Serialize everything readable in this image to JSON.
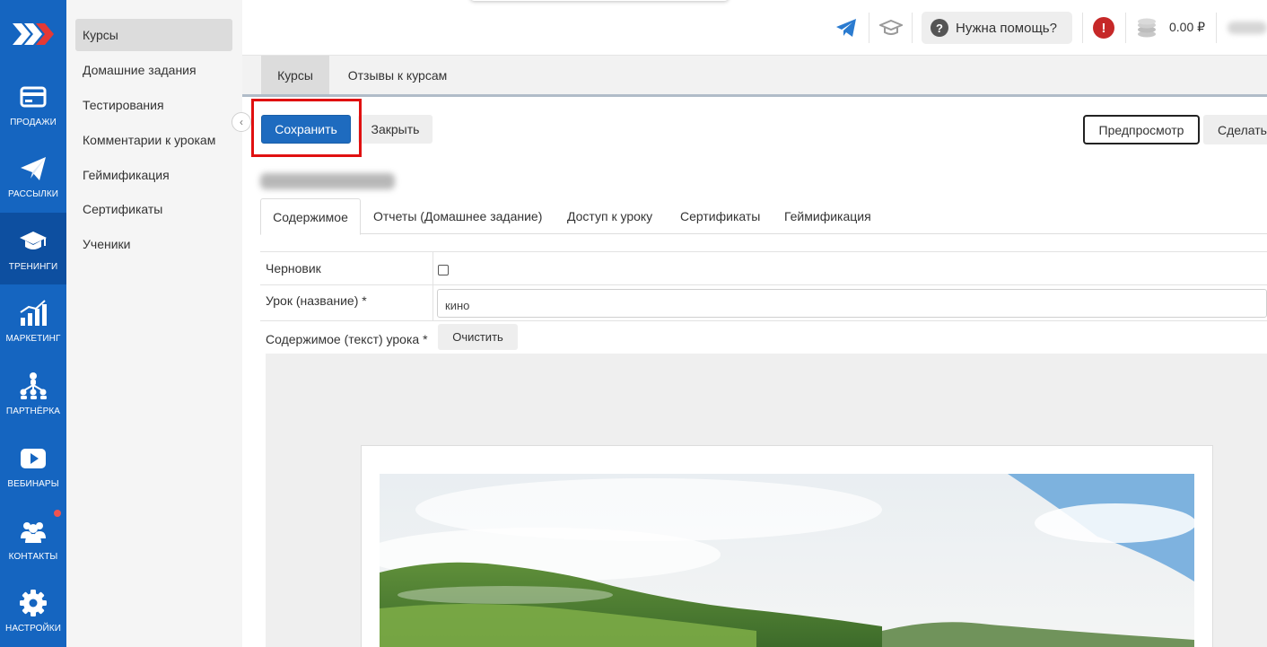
{
  "rail": {
    "items": [
      {
        "label": "ПРОДАЖИ",
        "icon": "card-icon"
      },
      {
        "label": "РАССЫЛКИ",
        "icon": "paper-plane-icon"
      },
      {
        "label": "ТРЕНИНГИ",
        "icon": "graduation-cap-icon"
      },
      {
        "label": "МАРКЕТИНГ",
        "icon": "bar-chart-icon"
      },
      {
        "label": "ПАРТНЁРКА",
        "icon": "partners-icon"
      },
      {
        "label": "ВЕБИНАРЫ",
        "icon": "play-icon"
      },
      {
        "label": "КОНТАКТЫ",
        "icon": "people-icon"
      },
      {
        "label": "НАСТРОЙКИ",
        "icon": "gear-icon"
      }
    ]
  },
  "subnav": {
    "items": [
      {
        "label": "Курсы"
      },
      {
        "label": "Домашние задания"
      },
      {
        "label": "Тестирования"
      },
      {
        "label": "Комментарии к урокам"
      },
      {
        "label": "Геймификация"
      },
      {
        "label": "Сертификаты"
      },
      {
        "label": "Ученики"
      }
    ]
  },
  "topbar": {
    "help_label": "Нужна помощь?",
    "balance": "0.00 ₽"
  },
  "main_tabs": [
    {
      "label": "Курсы"
    },
    {
      "label": "Отзывы к курсам"
    }
  ],
  "toolbar": {
    "save_label": "Сохранить",
    "close_label": "Закрыть",
    "preview_label": "Предпросмотр",
    "make_label": "Сделать"
  },
  "sub_tabs": [
    {
      "label": "Содержимое"
    },
    {
      "label": "Отчеты (Домашнее задание)"
    },
    {
      "label": "Доступ к уроку"
    },
    {
      "label": "Сертификаты"
    },
    {
      "label": "Геймификация"
    }
  ],
  "form": {
    "draft_label": "Черновик",
    "draft_checked": false,
    "name_label": "Урок (название) *",
    "name_value": "кино",
    "content_label": "Содержимое (текст) урока *",
    "clear_label": "Очистить"
  },
  "colors": {
    "rail": "#1565c0",
    "save_button": "#1e6bbf",
    "highlight": "#e01010"
  }
}
